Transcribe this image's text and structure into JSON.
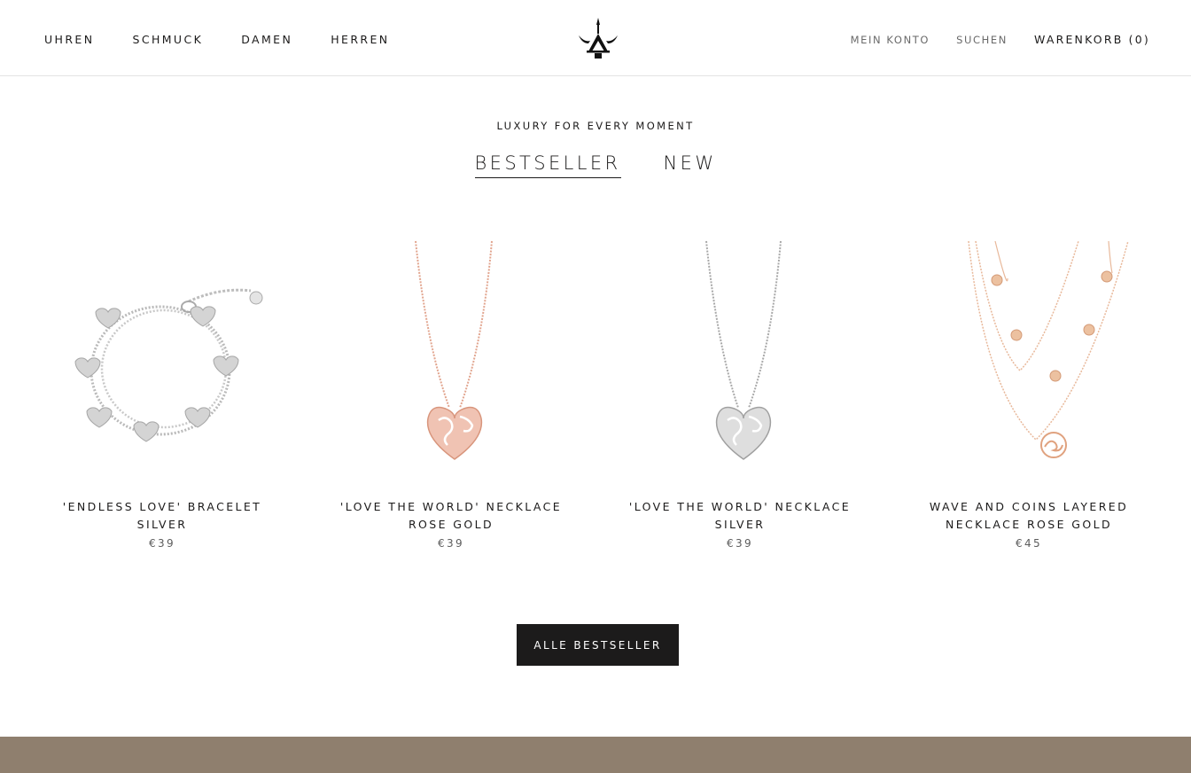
{
  "header": {
    "nav_left": [
      "UHREN",
      "SCHMUCK",
      "DAMEN",
      "HERREN"
    ],
    "account": "MEIN KONTO",
    "search": "SUCHEN",
    "cart": "WARENKORB (0)",
    "logo_icon": "trident-logo-icon"
  },
  "section": {
    "kicker": "LUXURY FOR EVERY MOMENT",
    "tabs": [
      {
        "label": "BESTSELLER",
        "active": true
      },
      {
        "label": "NEW",
        "active": false
      }
    ]
  },
  "products": [
    {
      "title": "'ENDLESS LOVE' BRACELET SILVER",
      "price": "€39",
      "image": "silver-heart-bracelet"
    },
    {
      "title": "'LOVE THE WORLD' NECKLACE ROSE GOLD",
      "price": "€39",
      "image": "rose-gold-heart-world-necklace"
    },
    {
      "title": "'LOVE THE WORLD' NECKLACE SILVER",
      "price": "€39",
      "image": "silver-heart-world-necklace"
    },
    {
      "title": "WAVE AND COINS LAYERED NECKLACE ROSE GOLD",
      "price": "€45",
      "image": "rose-gold-layered-coins-necklace"
    }
  ],
  "cta": {
    "label": "ALLE BESTSELLER"
  },
  "colors": {
    "accent": "#1c1b1b",
    "footer_band": "#8f7f6e",
    "rose_gold": "#e2a690",
    "silver": "#b9b9b9"
  }
}
